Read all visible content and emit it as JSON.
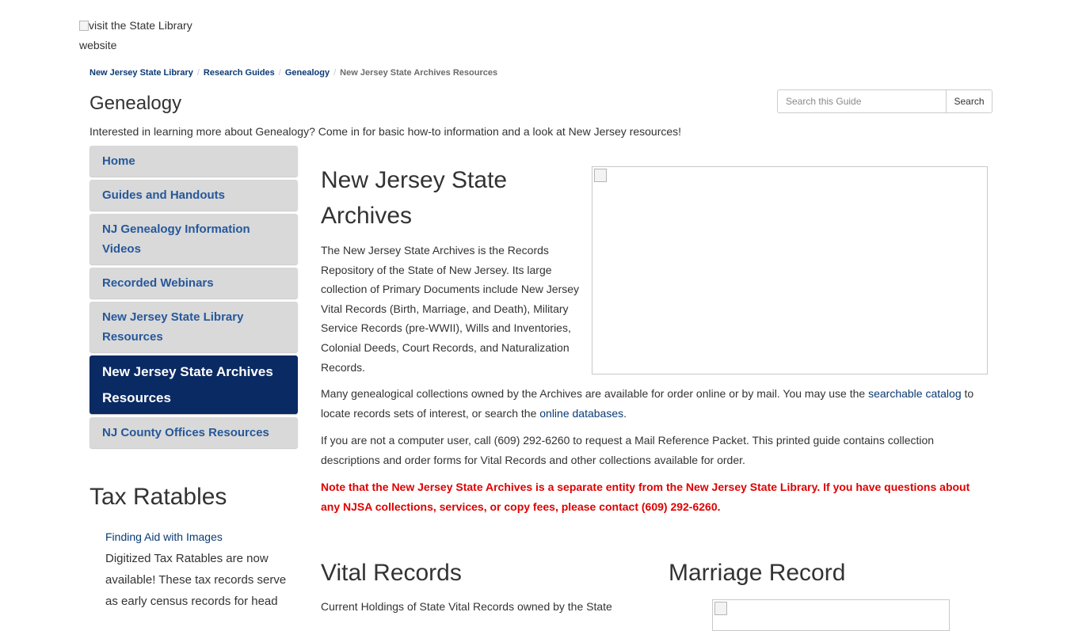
{
  "logo": {
    "alt_line1": "visit the State Library",
    "alt_line2": "website"
  },
  "breadcrumb": {
    "items": [
      "New Jersey State Library",
      "Research Guides",
      "Genealogy"
    ],
    "separator": "/",
    "current": "New Jersey State Archives Resources"
  },
  "page_title": "Genealogy",
  "search": {
    "placeholder": "Search this Guide",
    "button": "Search"
  },
  "guide_description": "Interested in learning more about Genealogy? Come in for basic how-to information and a look at New Jersey resources!",
  "sidenav": {
    "items": [
      {
        "label": "Home"
      },
      {
        "label": "Guides and Handouts"
      },
      {
        "label": "NJ Genealogy Information Videos"
      },
      {
        "label": "Recorded Webinars"
      },
      {
        "label": "New Jersey State Library Resources"
      },
      {
        "label": "New Jersey State Archives Resources",
        "active": true
      },
      {
        "label": "NJ County Offices Resources"
      }
    ]
  },
  "main": {
    "heading": "New Jersey State Archives",
    "intro": "The New Jersey State Archives is the Records Repository of the State of New Jersey.  Its large collection of Primary Documents include New Jersey Vital Records (Birth, Marriage, and Death), Military Service Records (pre-WWII), Wills and Inventories, Colonial Deeds, Court Records, and Naturalization Records.",
    "p1_before": "Many genealogical collections owned by the Archives are available for order online or by mail.  You may use the ",
    "p1_link1": "searchable catalog",
    "p1_middle": " to locate records sets of interest, or search the ",
    "p1_link2": "online databases",
    "p1_after": ".",
    "p2": "If you are not a computer user, call (609) 292-6260 to request a Mail Reference Packet.  This printed guide contains collection descriptions and order forms for Vital Records and other collections available for order.",
    "note": "Note that the New Jersey State Archives is a separate entity from the New Jersey State Library.  If you have questions about any NJSA collections, services, or copy fees, please contact (609) 292-6260."
  },
  "tax": {
    "title": "Tax Ratables",
    "link": "Finding Aid with Images",
    "text": "Digitized Tax Ratables are now available! These tax records serve as early census records for head"
  },
  "vital": {
    "title": "Vital Records",
    "text": "Current Holdings of State Vital Records owned by the State"
  },
  "marriage": {
    "title": "Marriage Record"
  },
  "colors": {
    "nav_active_bg": "#0a2a63",
    "nav_bg": "#d9d9d9",
    "nav_text": "#26589a",
    "note": "#e00000",
    "link": "#0a3a74"
  }
}
